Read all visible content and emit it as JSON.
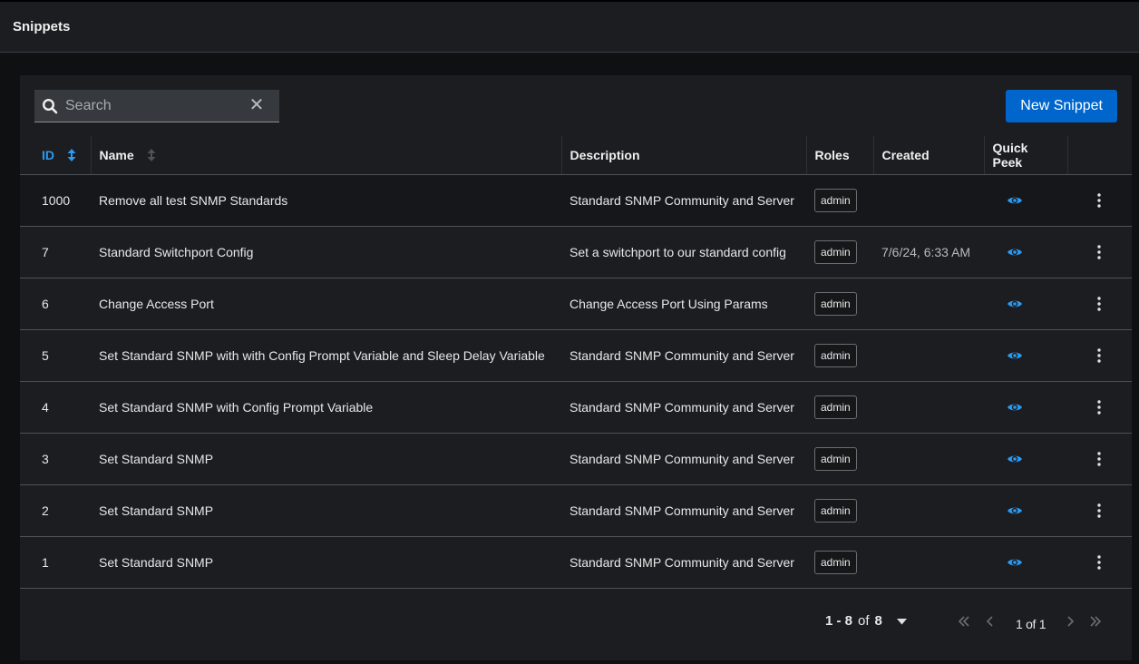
{
  "header": {
    "title": "Snippets"
  },
  "toolbar": {
    "search_placeholder": "Search",
    "new_button_label": "New Snippet"
  },
  "table": {
    "columns": {
      "id": "ID",
      "name": "Name",
      "description": "Description",
      "roles": "Roles",
      "created": "Created",
      "quick_peek": "Quick Peek"
    },
    "rows": [
      {
        "id": "1000",
        "name": "Remove all test SNMP Standards",
        "description": "Standard SNMP Community and Server",
        "role": "admin",
        "created": ""
      },
      {
        "id": "7",
        "name": "Standard Switchport Config",
        "description": "Set a switchport to our standard config",
        "role": "admin",
        "created": "7/6/24, 6:33 AM"
      },
      {
        "id": "6",
        "name": "Change Access Port",
        "description": "Change Access Port Using Params",
        "role": "admin",
        "created": ""
      },
      {
        "id": "5",
        "name": "Set Standard SNMP with with Config Prompt Variable and Sleep Delay Variable",
        "description": "Standard SNMP Community and Server",
        "role": "admin",
        "created": ""
      },
      {
        "id": "4",
        "name": "Set Standard SNMP with Config Prompt Variable",
        "description": "Standard SNMP Community and Server",
        "role": "admin",
        "created": ""
      },
      {
        "id": "3",
        "name": "Set Standard SNMP",
        "description": "Standard SNMP Community and Server",
        "role": "admin",
        "created": ""
      },
      {
        "id": "2",
        "name": "Set Standard SNMP",
        "description": "Standard SNMP Community and Server",
        "role": "admin",
        "created": ""
      },
      {
        "id": "1",
        "name": "Set Standard SNMP",
        "description": "Standard SNMP Community and Server",
        "role": "admin",
        "created": ""
      }
    ]
  },
  "pagination": {
    "range": "1 - 8",
    "of_word": "of",
    "total": "8",
    "page_of": "1 of 1"
  },
  "icons": {
    "search": "search-icon",
    "clear": "close-icon",
    "sort": "sort-icon",
    "quick_peek": "eye-icon",
    "row_actions": "kebab-icon"
  },
  "colors": {
    "accent": "#2b9af3",
    "primary_button": "#0066cc",
    "panel": "#1b1d21",
    "background": "#0f1012"
  }
}
